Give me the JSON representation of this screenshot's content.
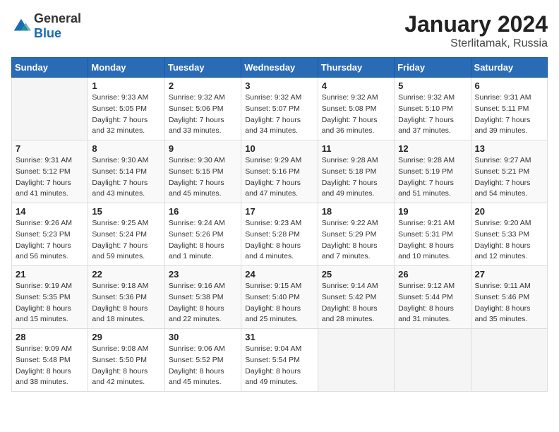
{
  "header": {
    "logo": {
      "general": "General",
      "blue": "Blue"
    },
    "title": "January 2024",
    "location": "Sterlitamak, Russia"
  },
  "weekdays": [
    "Sunday",
    "Monday",
    "Tuesday",
    "Wednesday",
    "Thursday",
    "Friday",
    "Saturday"
  ],
  "weeks": [
    [
      {
        "day": "",
        "sunrise": "",
        "sunset": "",
        "daylight": ""
      },
      {
        "day": "1",
        "sunrise": "9:33 AM",
        "sunset": "5:05 PM",
        "daylight": "7 hours and 32 minutes."
      },
      {
        "day": "2",
        "sunrise": "9:32 AM",
        "sunset": "5:06 PM",
        "daylight": "7 hours and 33 minutes."
      },
      {
        "day": "3",
        "sunrise": "9:32 AM",
        "sunset": "5:07 PM",
        "daylight": "7 hours and 34 minutes."
      },
      {
        "day": "4",
        "sunrise": "9:32 AM",
        "sunset": "5:08 PM",
        "daylight": "7 hours and 36 minutes."
      },
      {
        "day": "5",
        "sunrise": "9:32 AM",
        "sunset": "5:10 PM",
        "daylight": "7 hours and 37 minutes."
      },
      {
        "day": "6",
        "sunrise": "9:31 AM",
        "sunset": "5:11 PM",
        "daylight": "7 hours and 39 minutes."
      }
    ],
    [
      {
        "day": "7",
        "sunrise": "9:31 AM",
        "sunset": "5:12 PM",
        "daylight": "7 hours and 41 minutes."
      },
      {
        "day": "8",
        "sunrise": "9:30 AM",
        "sunset": "5:14 PM",
        "daylight": "7 hours and 43 minutes."
      },
      {
        "day": "9",
        "sunrise": "9:30 AM",
        "sunset": "5:15 PM",
        "daylight": "7 hours and 45 minutes."
      },
      {
        "day": "10",
        "sunrise": "9:29 AM",
        "sunset": "5:16 PM",
        "daylight": "7 hours and 47 minutes."
      },
      {
        "day": "11",
        "sunrise": "9:28 AM",
        "sunset": "5:18 PM",
        "daylight": "7 hours and 49 minutes."
      },
      {
        "day": "12",
        "sunrise": "9:28 AM",
        "sunset": "5:19 PM",
        "daylight": "7 hours and 51 minutes."
      },
      {
        "day": "13",
        "sunrise": "9:27 AM",
        "sunset": "5:21 PM",
        "daylight": "7 hours and 54 minutes."
      }
    ],
    [
      {
        "day": "14",
        "sunrise": "9:26 AM",
        "sunset": "5:23 PM",
        "daylight": "7 hours and 56 minutes."
      },
      {
        "day": "15",
        "sunrise": "9:25 AM",
        "sunset": "5:24 PM",
        "daylight": "7 hours and 59 minutes."
      },
      {
        "day": "16",
        "sunrise": "9:24 AM",
        "sunset": "5:26 PM",
        "daylight": "8 hours and 1 minute."
      },
      {
        "day": "17",
        "sunrise": "9:23 AM",
        "sunset": "5:28 PM",
        "daylight": "8 hours and 4 minutes."
      },
      {
        "day": "18",
        "sunrise": "9:22 AM",
        "sunset": "5:29 PM",
        "daylight": "8 hours and 7 minutes."
      },
      {
        "day": "19",
        "sunrise": "9:21 AM",
        "sunset": "5:31 PM",
        "daylight": "8 hours and 10 minutes."
      },
      {
        "day": "20",
        "sunrise": "9:20 AM",
        "sunset": "5:33 PM",
        "daylight": "8 hours and 12 minutes."
      }
    ],
    [
      {
        "day": "21",
        "sunrise": "9:19 AM",
        "sunset": "5:35 PM",
        "daylight": "8 hours and 15 minutes."
      },
      {
        "day": "22",
        "sunrise": "9:18 AM",
        "sunset": "5:36 PM",
        "daylight": "8 hours and 18 minutes."
      },
      {
        "day": "23",
        "sunrise": "9:16 AM",
        "sunset": "5:38 PM",
        "daylight": "8 hours and 22 minutes."
      },
      {
        "day": "24",
        "sunrise": "9:15 AM",
        "sunset": "5:40 PM",
        "daylight": "8 hours and 25 minutes."
      },
      {
        "day": "25",
        "sunrise": "9:14 AM",
        "sunset": "5:42 PM",
        "daylight": "8 hours and 28 minutes."
      },
      {
        "day": "26",
        "sunrise": "9:12 AM",
        "sunset": "5:44 PM",
        "daylight": "8 hours and 31 minutes."
      },
      {
        "day": "27",
        "sunrise": "9:11 AM",
        "sunset": "5:46 PM",
        "daylight": "8 hours and 35 minutes."
      }
    ],
    [
      {
        "day": "28",
        "sunrise": "9:09 AM",
        "sunset": "5:48 PM",
        "daylight": "8 hours and 38 minutes."
      },
      {
        "day": "29",
        "sunrise": "9:08 AM",
        "sunset": "5:50 PM",
        "daylight": "8 hours and 42 minutes."
      },
      {
        "day": "30",
        "sunrise": "9:06 AM",
        "sunset": "5:52 PM",
        "daylight": "8 hours and 45 minutes."
      },
      {
        "day": "31",
        "sunrise": "9:04 AM",
        "sunset": "5:54 PM",
        "daylight": "8 hours and 49 minutes."
      },
      {
        "day": "",
        "sunrise": "",
        "sunset": "",
        "daylight": ""
      },
      {
        "day": "",
        "sunrise": "",
        "sunset": "",
        "daylight": ""
      },
      {
        "day": "",
        "sunrise": "",
        "sunset": "",
        "daylight": ""
      }
    ]
  ]
}
